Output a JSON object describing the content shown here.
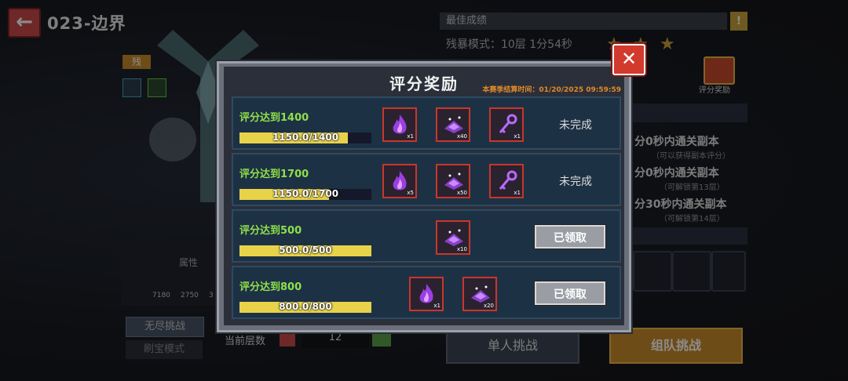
{
  "header": {
    "level_title": "023-边界",
    "back_icon": "back-arrow-icon"
  },
  "left": {
    "mode_tag": "残",
    "stats_title": "属性",
    "stats": [
      "7180",
      "2750",
      "3"
    ]
  },
  "tabs": {
    "endless": "无尽挑战",
    "treasure": "刷宝模式"
  },
  "floor": {
    "label": "当前层数",
    "value": "12"
  },
  "best": {
    "title": "最佳成绩",
    "record": "残暴模式：10层 1分54秒",
    "stars": [
      "★",
      "★",
      "★"
    ],
    "reward_label": "评分奖励"
  },
  "conditions": [
    {
      "text": "分0秒内通关副本",
      "sub": "（可以获得副本评分）"
    },
    {
      "text": "分0秒内通关副本",
      "sub": "（可解锁第13层）"
    },
    {
      "text": "分30秒内通关副本",
      "sub": "（可解锁第14层）"
    }
  ],
  "buttons": {
    "solo": "单人挑战",
    "team": "组队挑战"
  },
  "modal": {
    "title": "评分奖励",
    "season_end": "本赛季结算时间：01/20/2025 09:59:59",
    "close_icon": "close-x-icon",
    "rows": [
      {
        "condition": "评分达到1400",
        "progress_text": "1150.0/1400",
        "progress_fraction": 0.821,
        "items": [
          {
            "icon": "purple-flame-icon",
            "qty": "x1"
          },
          {
            "icon": "purple-crystal-pile-icon",
            "qty": "x40"
          },
          {
            "icon": "purple-key-icon",
            "qty": "x1"
          }
        ],
        "status": "未完成"
      },
      {
        "condition": "评分达到1700",
        "progress_text": "1150.0/1700",
        "progress_fraction": 0.676,
        "items": [
          {
            "icon": "purple-flame-icon",
            "qty": "x5"
          },
          {
            "icon": "purple-crystal-pile-icon",
            "qty": "x50"
          },
          {
            "icon": "purple-key-icon",
            "qty": "x1"
          }
        ],
        "status": "未完成"
      },
      {
        "condition": "评分达到500",
        "progress_text": "500.0/500",
        "progress_fraction": 1.0,
        "items": [
          {
            "icon": "purple-crystal-pile-icon",
            "qty": "x10"
          }
        ],
        "status": "已领取"
      },
      {
        "condition": "评分达到800",
        "progress_text": "800.0/800",
        "progress_fraction": 1.0,
        "items": [
          {
            "icon": "purple-flame-icon",
            "qty": "x1"
          },
          {
            "icon": "purple-crystal-pile-icon",
            "qty": "x20"
          }
        ],
        "status": "已领取"
      }
    ]
  },
  "colors": {
    "accent_orange": "#e08a2b",
    "progress_yellow": "#e8d24a",
    "condition_green": "#8fe04a",
    "close_red": "#d23a2e"
  }
}
